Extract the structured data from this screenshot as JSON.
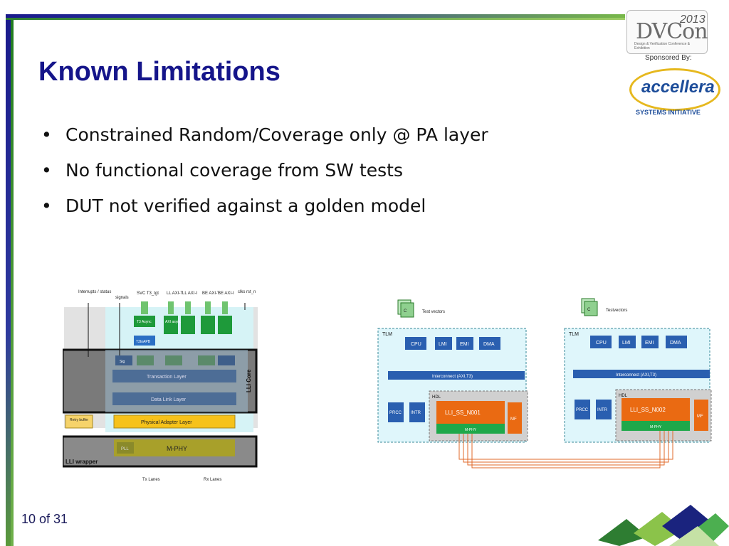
{
  "slide": {
    "title": "Known Limitations",
    "bullets": [
      "Constrained Random/Coverage only @ PA layer",
      "No functional coverage from SW tests",
      "DUT not verified against a golden model"
    ],
    "bullet_char": "•",
    "page_number": "10 of 31"
  },
  "header": {
    "dvcon_logo": "DVCon",
    "dvcon_year": "2013",
    "dvcon_sub": "Design & Verification Conference & Exhibition",
    "sponsored_by": "Sponsored By:",
    "accellera": "accellera",
    "systems_initiative": "SYSTEMS INITIATIVE"
  },
  "left_diagram": {
    "top_labels": [
      "Interrupts / status",
      "signals",
      "SVC T3_tgt",
      "LL AXI-T",
      "LL AXI-I",
      "BE AXI-T",
      "BE AXI-I",
      "clks rst_n"
    ],
    "t3_async": "T3 Async",
    "t3_to_apb": "T3toAPB",
    "axi_async": "AXI async",
    "sig": "Sig",
    "transaction_layer": "Transaction Layer",
    "data_link_layer": "Data Link Layer",
    "physical_adapter_layer": "Physical Adapter Layer",
    "retry_buffer": "Retry buffer",
    "lli_core": "LLI Core",
    "m_phy": "M-PHY",
    "pll": "PLL",
    "lli_wrapper": "LLI wrapper",
    "tx_lanes": "Tx Lanes",
    "rx_lanes": "Rx Lanes"
  },
  "right_diagram": {
    "test_vectors_a": "Test vectors",
    "test_vectors_b": "Testvectors",
    "file_c": "C",
    "tlm": "TLM",
    "hdl": "HDL",
    "cpu": "CPU",
    "lmi": "LMI",
    "emi": "EMI",
    "dma": "DMA",
    "interconnect": "Interconnect (AXI,T3)",
    "prcc": "PRCC",
    "intr": "INTR",
    "lli_ss_1": "LLI_SS_N001",
    "lli_ss_2": "LLI_SS_N002",
    "mf": "MF",
    "m_phy": "M-PHY"
  }
}
